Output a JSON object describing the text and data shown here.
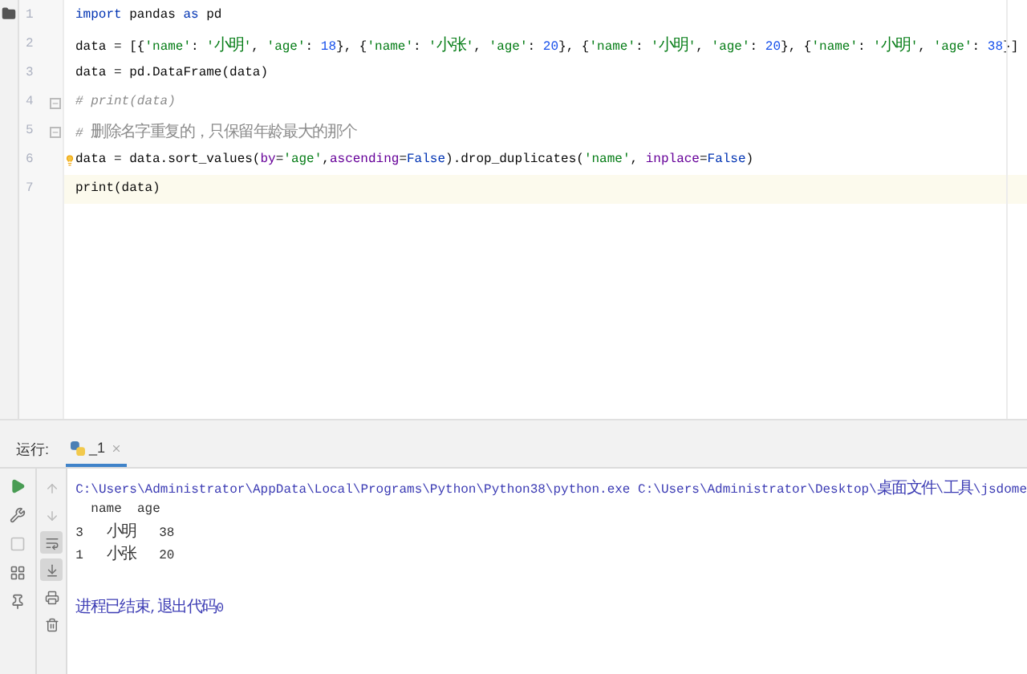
{
  "editor": {
    "lines": [
      {
        "number": "1",
        "current": false,
        "intention": false,
        "fold": false,
        "tokens": [
          {
            "kind": "kw",
            "text": "import"
          },
          {
            "kind": "plain",
            "text": " pandas "
          },
          {
            "kind": "kw",
            "text": "as"
          },
          {
            "kind": "plain",
            "text": " pd"
          }
        ]
      },
      {
        "number": "2",
        "current": false,
        "intention": false,
        "fold": false,
        "tokens": [
          {
            "kind": "plain",
            "text": "data = [{"
          },
          {
            "kind": "str",
            "text": "'name'"
          },
          {
            "kind": "plain",
            "text": ": "
          },
          {
            "kind": "str",
            "text": "'小明'"
          },
          {
            "kind": "plain",
            "text": ", "
          },
          {
            "kind": "str",
            "text": "'age'"
          },
          {
            "kind": "plain",
            "text": ": "
          },
          {
            "kind": "num",
            "text": "18"
          },
          {
            "kind": "plain",
            "text": "}, {"
          },
          {
            "kind": "str",
            "text": "'name'"
          },
          {
            "kind": "plain",
            "text": ": "
          },
          {
            "kind": "str",
            "text": "'小张'"
          },
          {
            "kind": "plain",
            "text": ", "
          },
          {
            "kind": "str",
            "text": "'age'"
          },
          {
            "kind": "plain",
            "text": ": "
          },
          {
            "kind": "num",
            "text": "20"
          },
          {
            "kind": "plain",
            "text": "}, {"
          },
          {
            "kind": "str",
            "text": "'name'"
          },
          {
            "kind": "plain",
            "text": ": "
          },
          {
            "kind": "str",
            "text": "'小明'"
          },
          {
            "kind": "plain",
            "text": ", "
          },
          {
            "kind": "str",
            "text": "'age'"
          },
          {
            "kind": "plain",
            "text": ": "
          },
          {
            "kind": "num",
            "text": "20"
          },
          {
            "kind": "plain",
            "text": "}, {"
          },
          {
            "kind": "str",
            "text": "'name'"
          },
          {
            "kind": "plain",
            "text": ": "
          },
          {
            "kind": "str",
            "text": "'小明'"
          },
          {
            "kind": "plain",
            "text": ", "
          },
          {
            "kind": "str",
            "text": "'age'"
          },
          {
            "kind": "plain",
            "text": ": "
          },
          {
            "kind": "num",
            "text": "38"
          },
          {
            "kind": "plain",
            "text": "}]"
          }
        ]
      },
      {
        "number": "3",
        "current": false,
        "intention": false,
        "fold": false,
        "tokens": [
          {
            "kind": "plain",
            "text": "data = pd.DataFrame(data)"
          }
        ]
      },
      {
        "number": "4",
        "current": false,
        "intention": false,
        "fold": true,
        "tokens": [
          {
            "kind": "comment",
            "text": "# print(data)"
          }
        ]
      },
      {
        "number": "5",
        "current": false,
        "intention": false,
        "fold": true,
        "tokens": [
          {
            "kind": "comment",
            "text": "# 删除名字重复的，只保留年龄最大的那个"
          }
        ]
      },
      {
        "number": "6",
        "current": false,
        "intention": true,
        "fold": false,
        "tokens": [
          {
            "kind": "plain",
            "text": "data = data.sort_values("
          },
          {
            "kind": "kwarg",
            "text": "by"
          },
          {
            "kind": "plain",
            "text": "="
          },
          {
            "kind": "str",
            "text": "'age'"
          },
          {
            "kind": "plain",
            "text": ","
          },
          {
            "kind": "kwarg",
            "text": "ascending"
          },
          {
            "kind": "plain",
            "text": "="
          },
          {
            "kind": "kw",
            "text": "False"
          },
          {
            "kind": "plain",
            "text": ").drop_duplicates("
          },
          {
            "kind": "str",
            "text": "'name'"
          },
          {
            "kind": "plain",
            "text": ", "
          },
          {
            "kind": "kwarg",
            "text": "inplace"
          },
          {
            "kind": "plain",
            "text": "="
          },
          {
            "kind": "kw",
            "text": "False"
          },
          {
            "kind": "plain",
            "text": ")"
          }
        ]
      },
      {
        "number": "7",
        "current": true,
        "intention": false,
        "fold": false,
        "tokens": [
          {
            "kind": "plain",
            "text": "print(data)"
          }
        ]
      }
    ]
  },
  "run_panel": {
    "label": "运行:",
    "tabs": [
      {
        "label": "_1",
        "selected": true
      }
    ],
    "toolbar_secondary": [
      {
        "on": false
      },
      {
        "on": false
      },
      {
        "on": true
      },
      {
        "on": true
      },
      {
        "on": false
      },
      {
        "on": false
      }
    ],
    "output": [
      {
        "kind": "command",
        "text": "C:\\Users\\Administrator\\AppData\\Local\\Programs\\Python\\Python38\\python.exe C:\\Users\\Administrator\\Desktop\\桌面文件\\工具\\jsdome"
      },
      {
        "kind": "stdout",
        "text": "  name  age"
      },
      {
        "kind": "stdout",
        "text": "3   小明   38"
      },
      {
        "kind": "stdout",
        "text": "1   小张   20"
      },
      {
        "kind": "exit",
        "text": "进程已结束,退出代码0"
      }
    ]
  }
}
